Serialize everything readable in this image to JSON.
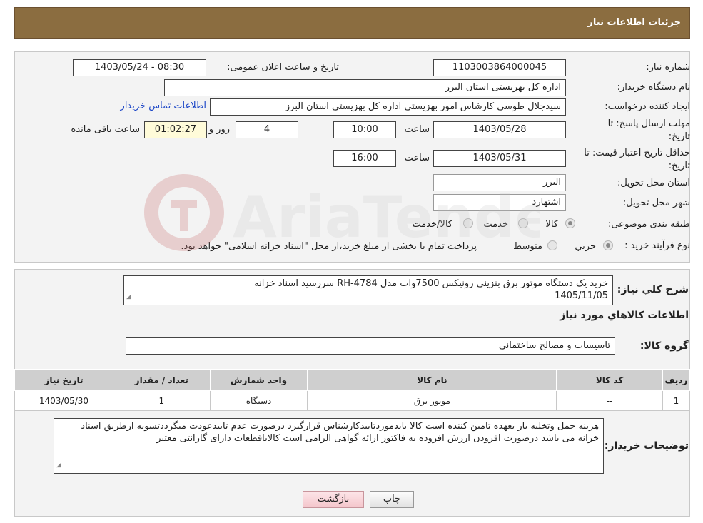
{
  "header": {
    "title": "جزئیات اطلاعات نیاز"
  },
  "fields": {
    "need_number": {
      "label": "شماره نیاز:",
      "value": "1103003864000045"
    },
    "announce_datetime": {
      "label": "تاریخ و ساعت اعلان عمومی:",
      "value": "1403/05/24 - 08:30"
    },
    "buyer_org": {
      "label": "نام دستگاه خریدار:",
      "value": "اداره کل بهزیستی استان البرز"
    },
    "requester": {
      "label": "ایجاد کننده درخواست:",
      "value": "سیدجلال طوسی کارشاس امور بهزیستی اداره کل بهزیستی استان البرز",
      "contact_link": "اطلاعات تماس خریدار"
    },
    "reply_deadline": {
      "label": "مهلت ارسال پاسخ: تا تاریخ:",
      "date": "1403/05/28",
      "time_label": "ساعت",
      "time": "10:00",
      "days": "4",
      "days_label": "روز و",
      "remaining": "01:02:27",
      "remaining_label": "ساعت باقی مانده"
    },
    "price_validity": {
      "label": "حداقل تاریخ اعتبار قیمت: تا تاریخ:",
      "date": "1403/05/31",
      "time_label": "ساعت",
      "time": "16:00"
    },
    "province": {
      "label": "استان محل تحویل:",
      "value": "البرز"
    },
    "city": {
      "label": "شهر محل تحویل:",
      "value": "اشتهارد"
    },
    "category": {
      "label": "طبقه بندی موضوعی:",
      "options": [
        "کالا",
        "خدمت",
        "کالا/خدمت"
      ],
      "selected": "کالا"
    },
    "process": {
      "label": "نوع فرآیند خرید :",
      "options": [
        "جزیي",
        "متوسط"
      ],
      "selected": "جزیي",
      "note": "پرداخت تمام یا بخشی از مبلغ خرید،از محل \"اسناد خزانه اسلامی\" خواهد بود."
    }
  },
  "description": {
    "label": "شرح کلي نياز:",
    "line1": "خرید یک دستگاه موتور برق بنزینی رونیکس 7500وات  مدل RH-4784          سررسید اسناد خزانه",
    "line2": "1405/11/05"
  },
  "items_section": {
    "title": "اطلاعات کالاهاي مورد نياز",
    "group_label": "گروه کالا:",
    "group_value": "تاسیسات و مصالح ساختمانی"
  },
  "table": {
    "headers": [
      "رديف",
      "کد کالا",
      "نام کالا",
      "واحد شمارش",
      "تعداد / مقدار",
      "تاريخ نياز"
    ],
    "rows": [
      [
        "1",
        "--",
        "موتور برق",
        "دستگاه",
        "1",
        "1403/05/30"
      ]
    ]
  },
  "buyer_notes": {
    "label": "توضیحات خریدار:",
    "text": "هزینه حمل وتخلیه بار بعهده تامین کننده است کالا بایدموردتاییدکارشناس قرارگیرد درصورت عدم تاییدعودت میگرددتسویه ازطریق اسناد خزانه می باشد درصورت افزودن ارزش افزوده به فاکتور ارائه گواهی الزامی است کالاباقطعات دارای گارانتی معتبر"
  },
  "buttons": {
    "print": "چاپ",
    "back": "بازگشت"
  },
  "watermark": {
    "text": "AriaTender.neT"
  },
  "colors": {
    "header_bg": "#8b6d40",
    "link": "#1e48c7",
    "back_button": "#f4c6cc"
  }
}
